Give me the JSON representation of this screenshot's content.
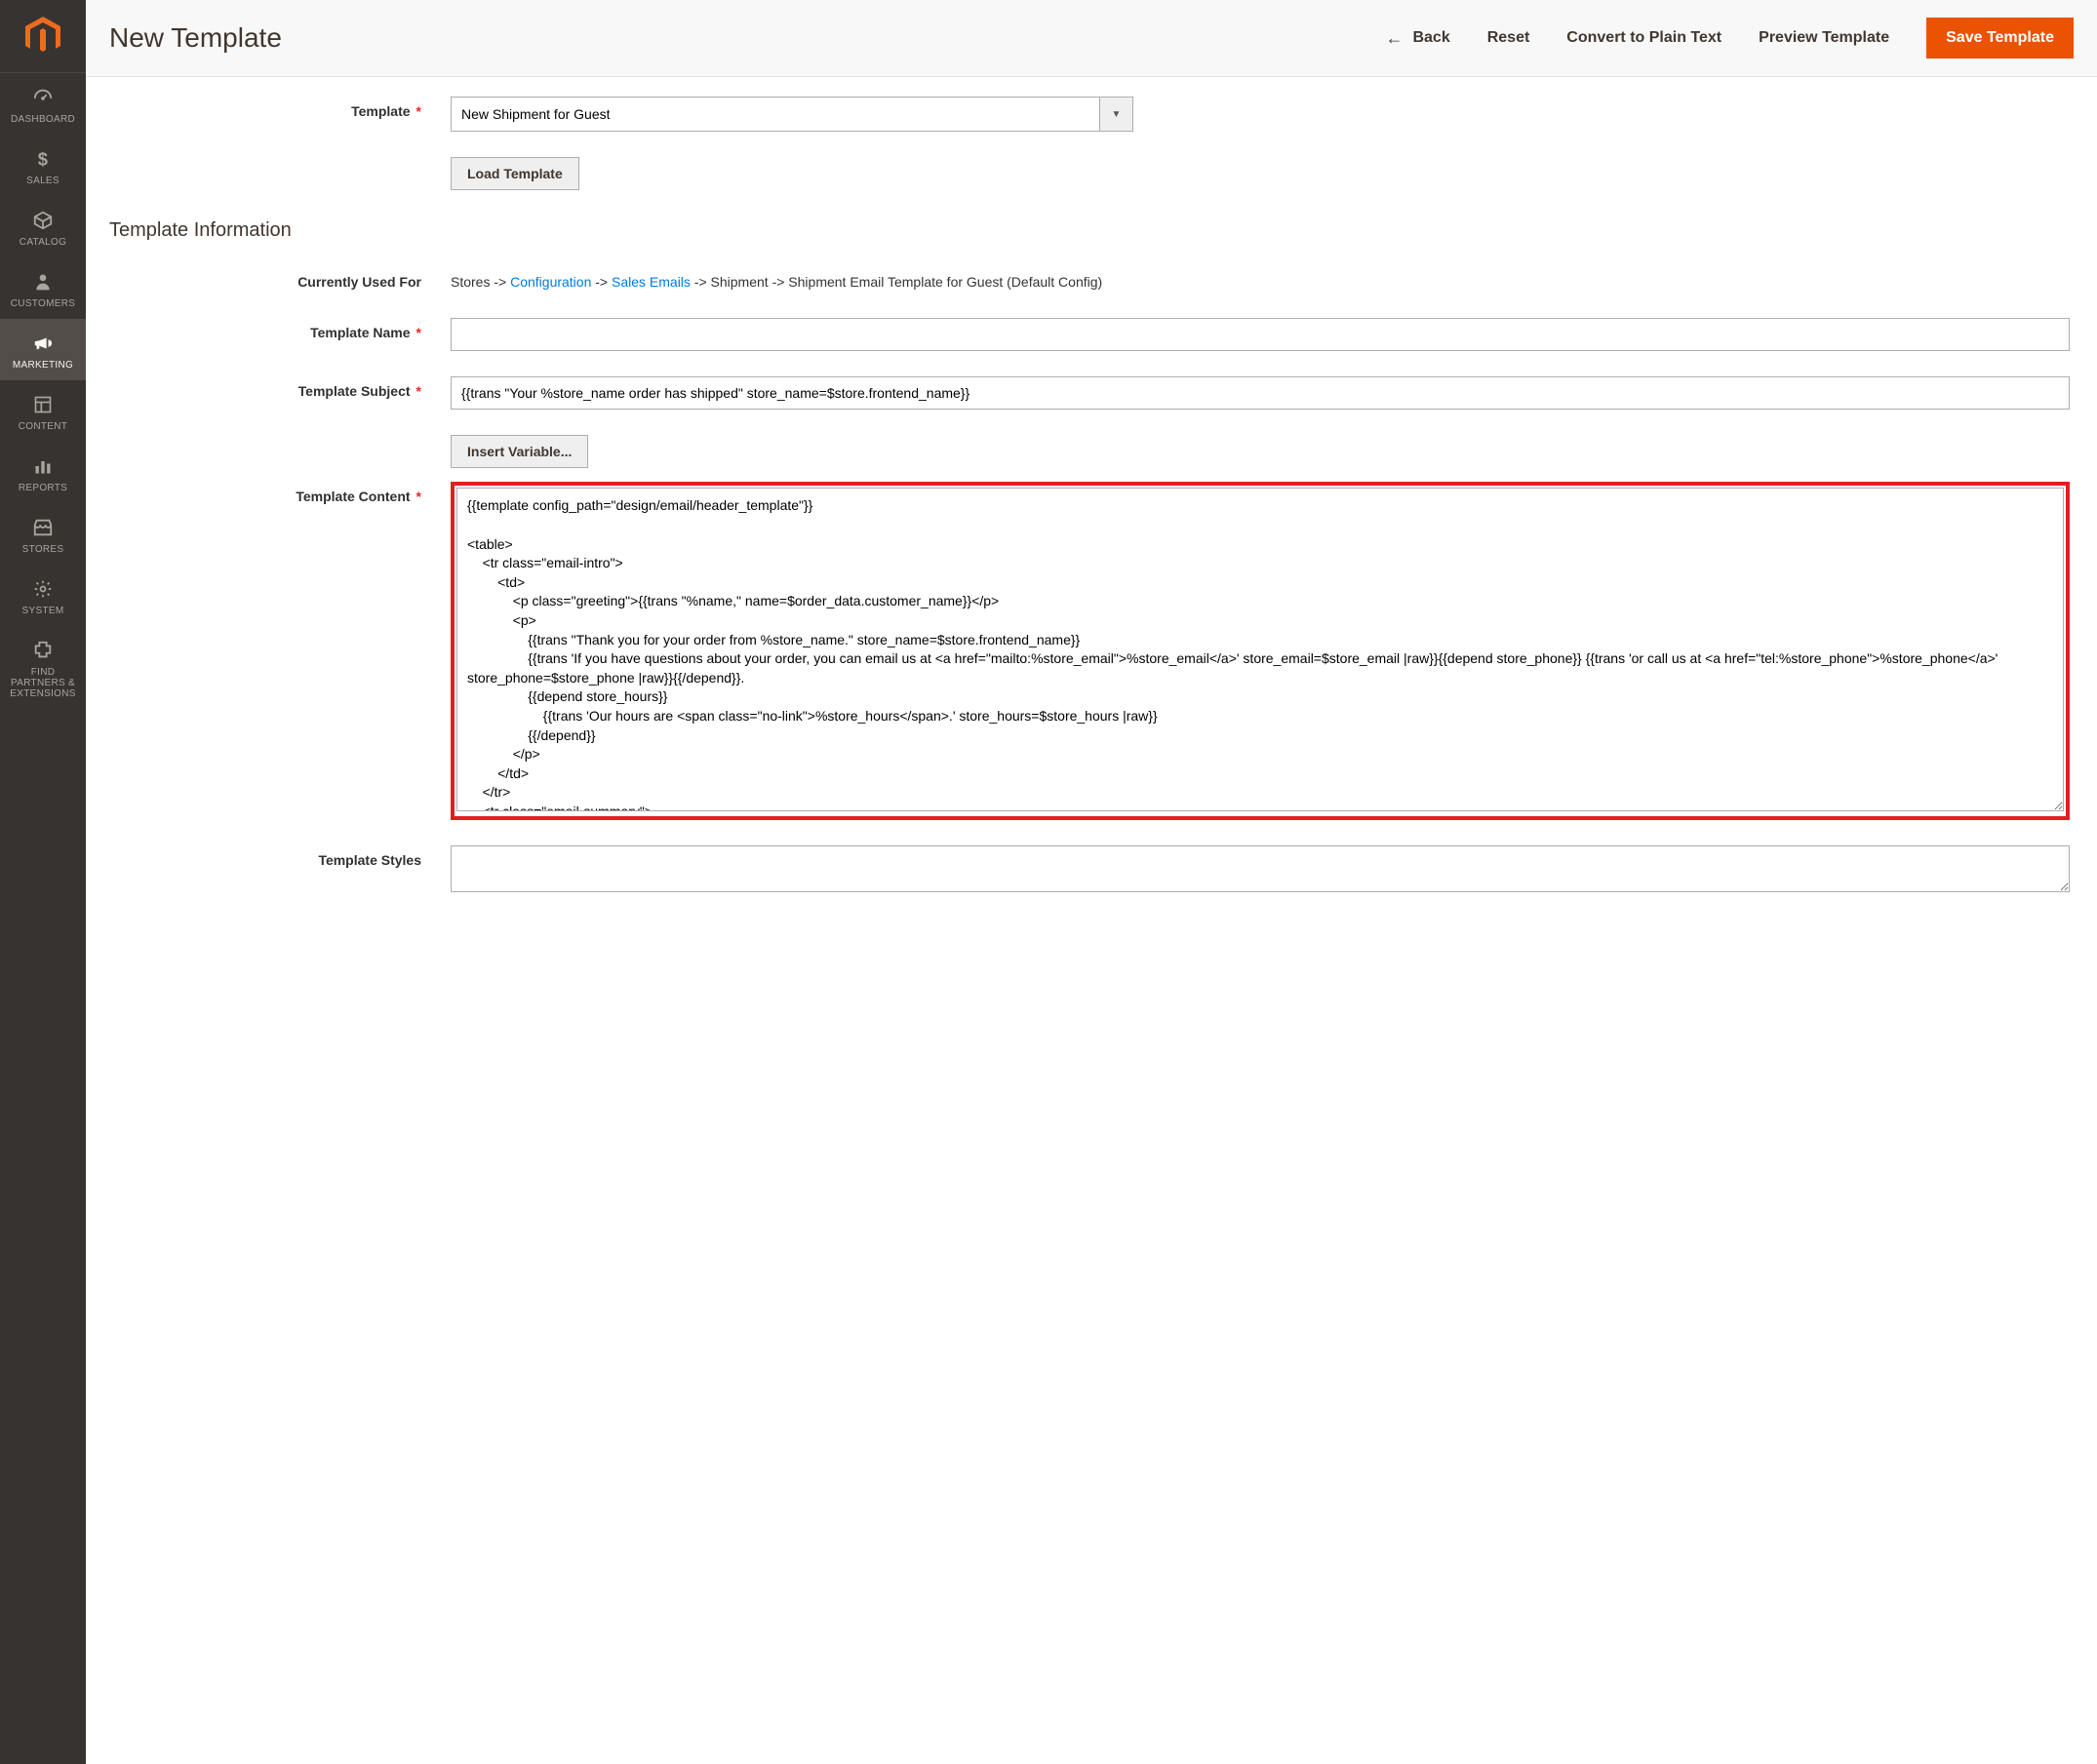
{
  "header": {
    "page_title": "New Template",
    "back": "Back",
    "reset": "Reset",
    "convert": "Convert to Plain Text",
    "preview": "Preview Template",
    "save": "Save Template"
  },
  "sidebar": {
    "items": [
      {
        "label": "DASHBOARD"
      },
      {
        "label": "SALES"
      },
      {
        "label": "CATALOG"
      },
      {
        "label": "CUSTOMERS"
      },
      {
        "label": "MARKETING"
      },
      {
        "label": "CONTENT"
      },
      {
        "label": "REPORTS"
      },
      {
        "label": "STORES"
      },
      {
        "label": "SYSTEM"
      },
      {
        "label": "FIND PARTNERS & EXTENSIONS"
      }
    ]
  },
  "form": {
    "template_label": "Template",
    "template_value": "New Shipment for Guest",
    "load_template": "Load Template",
    "section_title": "Template Information",
    "currently_used_label": "Currently Used For",
    "currently_used": {
      "prefix": "Stores -> ",
      "link1": "Configuration",
      "mid1": " -> ",
      "link2": "Sales Emails",
      "suffix": " -> Shipment -> Shipment Email Template for Guest  (Default Config)"
    },
    "template_name_label": "Template Name",
    "template_name_value": "",
    "template_subject_label": "Template Subject",
    "template_subject_value": "{{trans \"Your %store_name order has shipped\" store_name=$store.frontend_name}}",
    "insert_variable": "Insert Variable...",
    "template_content_label": "Template Content",
    "template_content_value": "{{template config_path=\"design/email/header_template\"}}\n\n<table>\n    <tr class=\"email-intro\">\n        <td>\n            <p class=\"greeting\">{{trans \"%name,\" name=$order_data.customer_name}}</p>\n            <p>\n                {{trans \"Thank you for your order from %store_name.\" store_name=$store.frontend_name}}\n                {{trans 'If you have questions about your order, you can email us at <a href=\"mailto:%store_email\">%store_email</a>' store_email=$store_email |raw}}{{depend store_phone}} {{trans 'or call us at <a href=\"tel:%store_phone\">%store_phone</a>' store_phone=$store_phone |raw}}{{/depend}}.\n                {{depend store_hours}}\n                    {{trans 'Our hours are <span class=\"no-link\">%store_hours</span>.' store_hours=$store_hours |raw}}\n                {{/depend}}\n            </p>\n        </td>\n    </tr>\n    <tr class=\"email-summary\">",
    "template_styles_label": "Template Styles",
    "template_styles_value": ""
  }
}
